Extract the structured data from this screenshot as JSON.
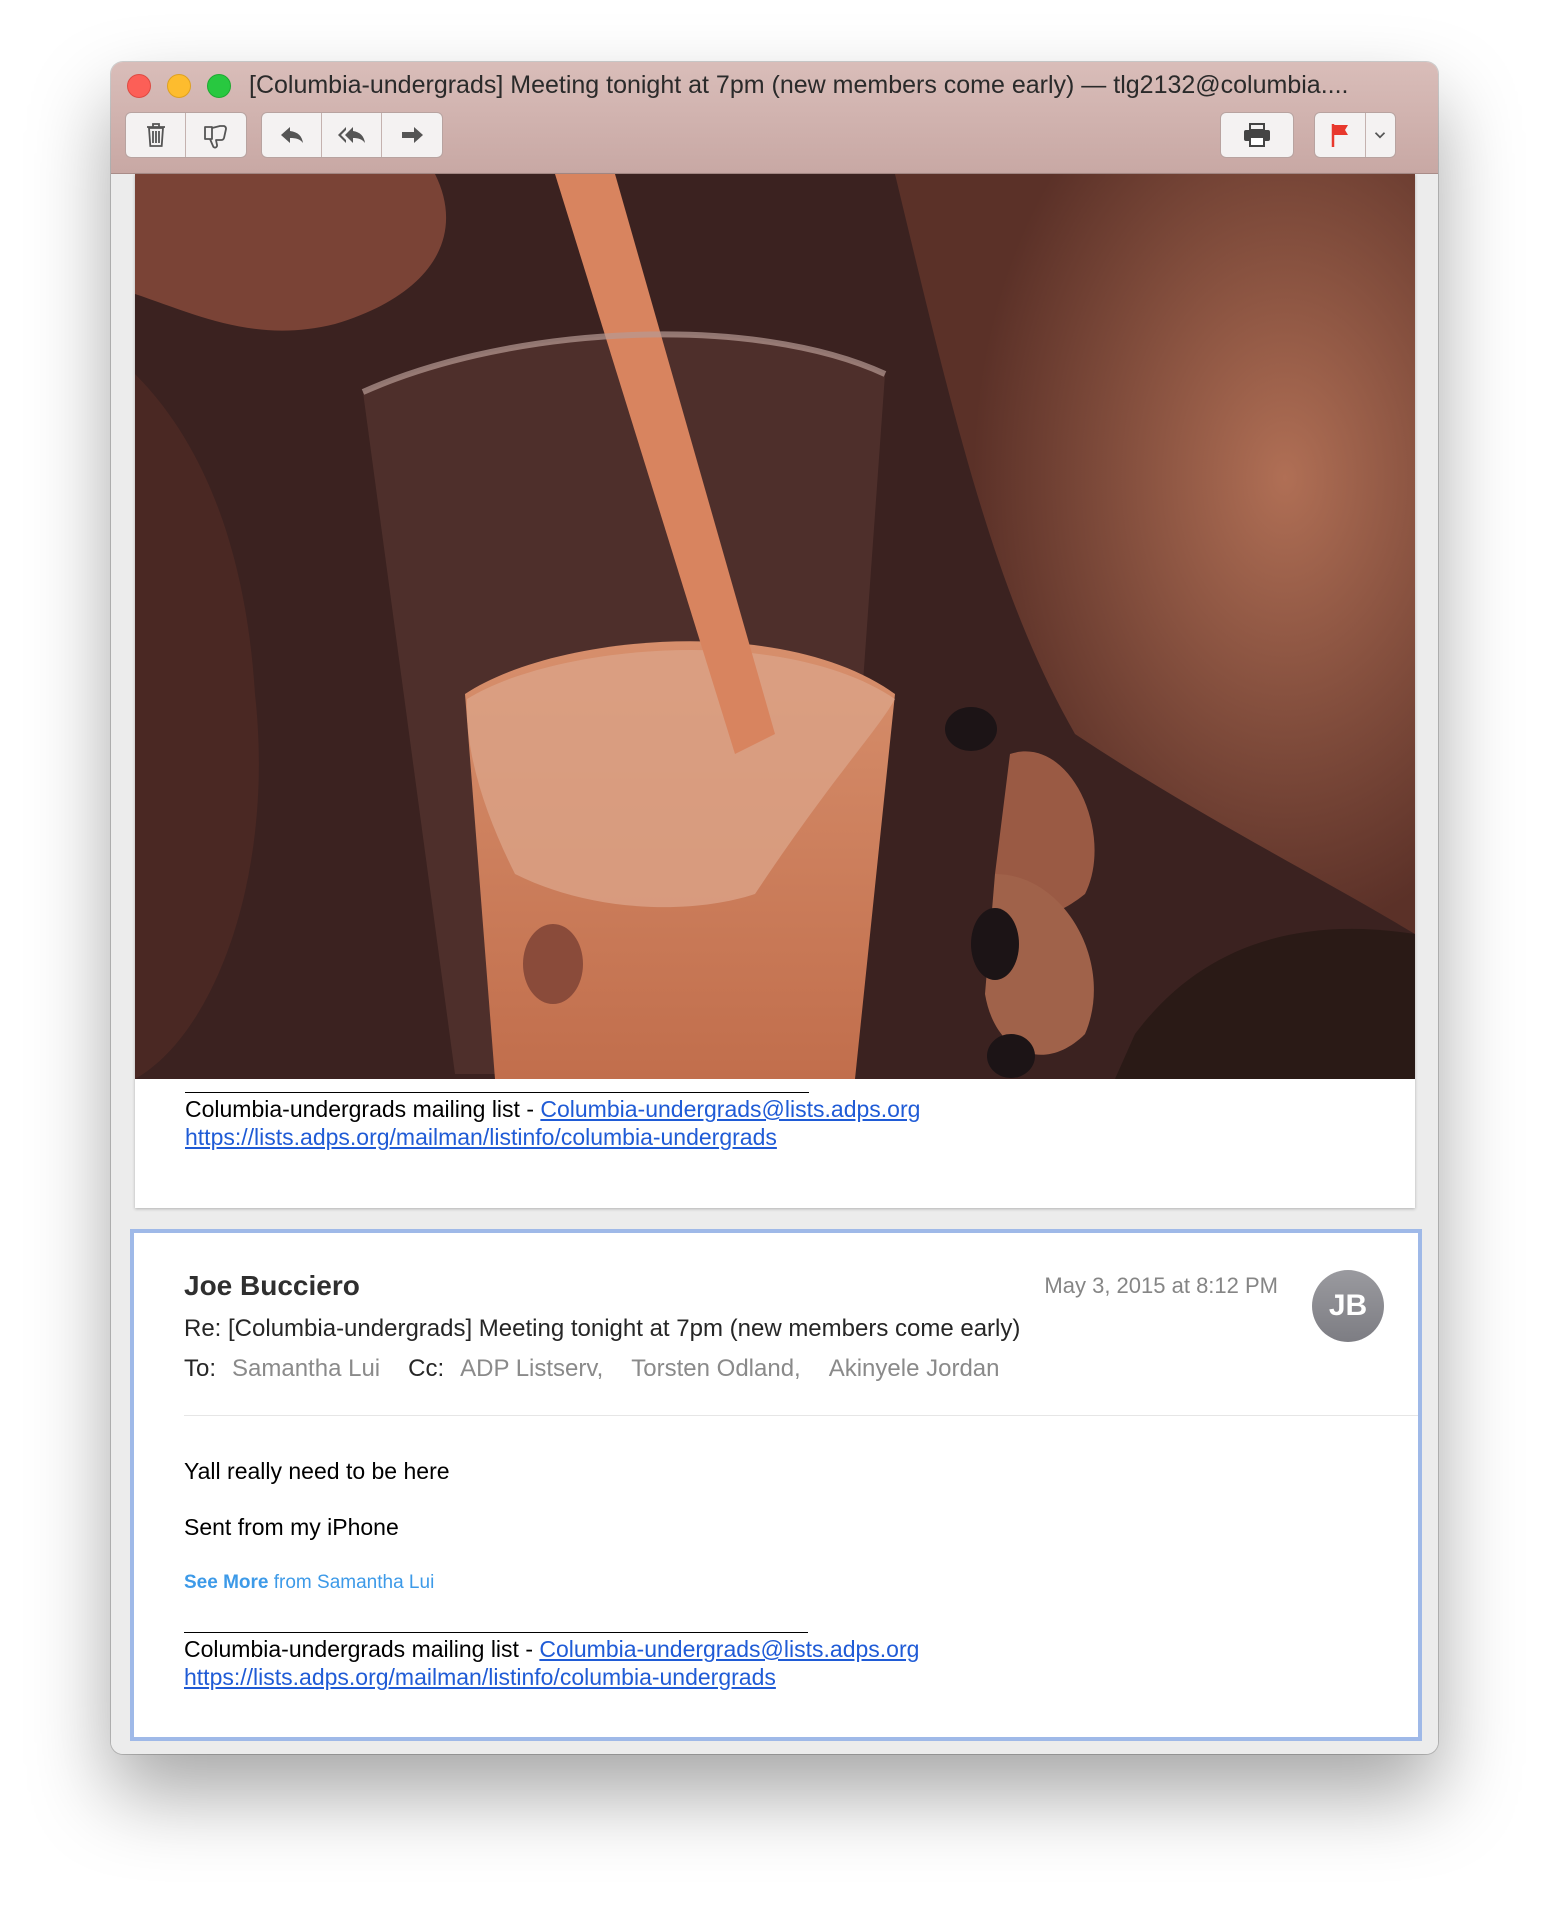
{
  "window": {
    "title": "[Columbia-undergrads] Meeting tonight at 7pm (new members come early) — tlg2132@columbia...."
  },
  "toolbar": {
    "buttons": [
      "trash-icon",
      "junk-icon",
      "reply-icon",
      "reply-all-icon",
      "forward-icon",
      "print-icon",
      "flag-icon",
      "chevron-down-icon"
    ],
    "flag_color": "#e8382d"
  },
  "message1": {
    "footer": {
      "list_name": "Columbia-undergrads mailing list  - ",
      "list_email": "Columbia-undergrads@lists.adps.org",
      "list_url": "https://lists.adps.org/mailman/listinfo/columbia-undergrads"
    }
  },
  "message2": {
    "sender": "Joe Bucciero",
    "date": "May 3, 2015 at 8:12 PM",
    "avatar_initials": "JB",
    "subject": "Re: [Columbia-undergrads] Meeting tonight at 7pm (new members come early)",
    "to_label": "To:",
    "to": "Samantha Lui",
    "cc_label": "Cc:",
    "cc": [
      "ADP Listserv,",
      "Torsten Odland,",
      "Akinyele Jordan"
    ],
    "body": [
      "Yall really need to be here",
      "Sent from my iPhone"
    ],
    "see_more_bold": "See More",
    "see_more_rest": " from Samantha Lui",
    "footer": {
      "list_name": "Columbia-undergrads mailing list  - ",
      "list_email": "Columbia-undergrads@lists.adps.org",
      "list_url": "https://lists.adps.org/mailman/listinfo/columbia-undergrads"
    }
  },
  "colors": {
    "link": "#1f5bd6",
    "selection_border": "#9fb9e8",
    "see_more": "#3d9ae8"
  }
}
